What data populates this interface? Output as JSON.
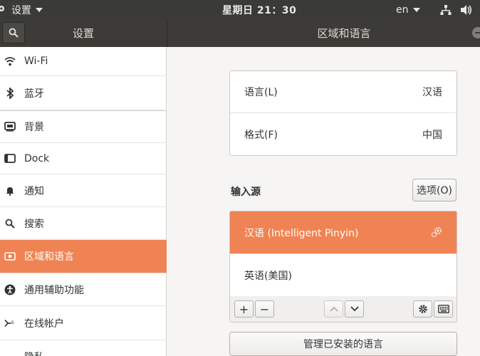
{
  "top_panel": {
    "app_name": "设置",
    "clock": "星期日 21：30",
    "input_indicator": "en"
  },
  "header": {
    "sidebar_title": "设置",
    "page_title": "区域和语言"
  },
  "sidebar": {
    "items": [
      {
        "label": "Wi-Fi",
        "icon": "wifi-icon"
      },
      {
        "label": "蓝牙",
        "icon": "bluetooth-icon"
      },
      {
        "label": "背景",
        "icon": "background-icon"
      },
      {
        "label": "Dock",
        "icon": "dock-icon"
      },
      {
        "label": "通知",
        "icon": "bell-icon"
      },
      {
        "label": "搜索",
        "icon": "search-icon"
      },
      {
        "label": "区域和语言",
        "icon": "region-flag-icon",
        "active": true
      },
      {
        "label": "通用辅助功能",
        "icon": "accessibility-icon"
      },
      {
        "label": "在线帐户",
        "icon": "online-accounts-icon"
      },
      {
        "label": "隐私",
        "icon": "privacy-icon"
      }
    ]
  },
  "main": {
    "language": {
      "label": "语言(L)",
      "value": "汉语"
    },
    "formats": {
      "label": "格式(F)",
      "value": "中国"
    },
    "input_sources": {
      "title": "输入源",
      "options_button": "选项(O)",
      "items": [
        {
          "name": "汉语 (Intelligent Pinyin)",
          "selected": true
        },
        {
          "name": "英语(美国)",
          "selected": false
        }
      ],
      "toolbar": {
        "add": "+",
        "remove": "−"
      }
    },
    "manage_button": "管理已安装的语言"
  },
  "colors": {
    "accent": "#f08353",
    "panel_dark": "#3a3a38",
    "header_dark": "#3c3b37"
  }
}
